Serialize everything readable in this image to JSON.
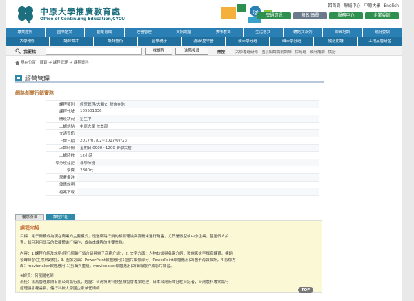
{
  "header": {
    "logo_cn": "中原大學推廣教育處",
    "logo_en": "Office of Continuing Education,CYCU",
    "top_links": [
      "回首頁",
      "聯絡中心",
      "中原大學",
      "English"
    ],
    "quick_buttons": [
      "交通資訊",
      "報名/繳費",
      "服務中心",
      "企業委訓"
    ]
  },
  "nav": {
    "row1": [
      "專業證照",
      "國際語文",
      "創業育成",
      "經營管理",
      "資訊電腦",
      "美味食尚",
      "生活藝文",
      "輔諮文系列",
      "師資培訓",
      "政府委訓"
    ],
    "row2": [
      "大學預修",
      "講師徵才",
      "設計藝術",
      "音樂親子",
      "游泳/夏令營",
      "碩士學分班",
      "碩士學分班",
      "隨班附讀",
      "工地品管研習"
    ]
  },
  "search": {
    "label": "我要找",
    "placeholder": "",
    "find_button": "找課程",
    "advanced_button": "進階搜尋",
    "hot_label": "熱搜：",
    "hot_items": [
      "大學專班研修",
      "國小知識職前訓練",
      "保母班",
      "政府補助",
      "烘焙"
    ]
  },
  "breadcrumb": "現在位置：首頁 → 課程管理 → 課程資料",
  "page_title": "經營管理",
  "course_title": "網路創業行銷實務",
  "info_rows": [
    {
      "label": "課程類別",
      "value": "經營管理(大類)：財會金融"
    },
    {
      "label": "課程代號",
      "value": "105501636"
    },
    {
      "label": "開班狀況",
      "value": "招生中"
    },
    {
      "label": "上課地點",
      "value": "中原大學 校本部"
    },
    {
      "label": "交通資訊",
      "value": ""
    },
    {
      "label": "上課日期",
      "value": "2017/07/02~2017/07/23"
    },
    {
      "label": "上課時間",
      "value": "星期日 0900~1200 夢學大樓"
    },
    {
      "label": "上課時數",
      "value": "12小時"
    },
    {
      "label": "學分班註記",
      "value": "非學分班"
    },
    {
      "label": "學費",
      "value": "2800元"
    },
    {
      "label": "學費備註",
      "value": ""
    },
    {
      "label": "優惠說明",
      "value": ""
    },
    {
      "label": "檔案下載",
      "value": ""
    }
  ],
  "tabs": [
    "優惠辦法",
    "課程介紹"
  ],
  "intro": {
    "title": "課程介紹",
    "paragraphs": [
      "目標：電子商務成為現在商業的主要模式，透過網路行銷的相關理論與實務來進行銷售，尤其是微型或中小企業，甚至個人拍",
      "賣，如何利用既有的軟硬體進行操作，成為本課程的主要重點。",
      "內容：1.課程介紹及說明(現行網路行銷介紹與電子商務介紹)，2. 文字方面：人物訪談與名家介紹，微電影文字撰寫練習，標題",
      "發聲練習(主標與副標)，3. 圖像方面：PowerPoint軟體應用(1)圖片編修部分，PowerPoint軟體應用(2)圖卡海報設計，4.影像方",
      "面：movienaker軟體應用(1)剪輯與重組，movienaker軟體應用(2)簡報製作成影片練習。",
      "※師資：何昆陽老師",
      "現任：法馬管理顧問有限公司執行長，經歷：台灣博奧科技發展協會專案經理，日本台灣新聞社駐台記者，台灣農科專案執行",
      "經理協會秘書長，健行科技大學國企系兼任講師"
    ]
  },
  "top_button": "TOP",
  "colors": {
    "nav_blue": "#2a7fb5",
    "quick_green": "#2f8f4e",
    "intro_bg": "#fbf8d6",
    "title_orange": "#b5773a"
  }
}
